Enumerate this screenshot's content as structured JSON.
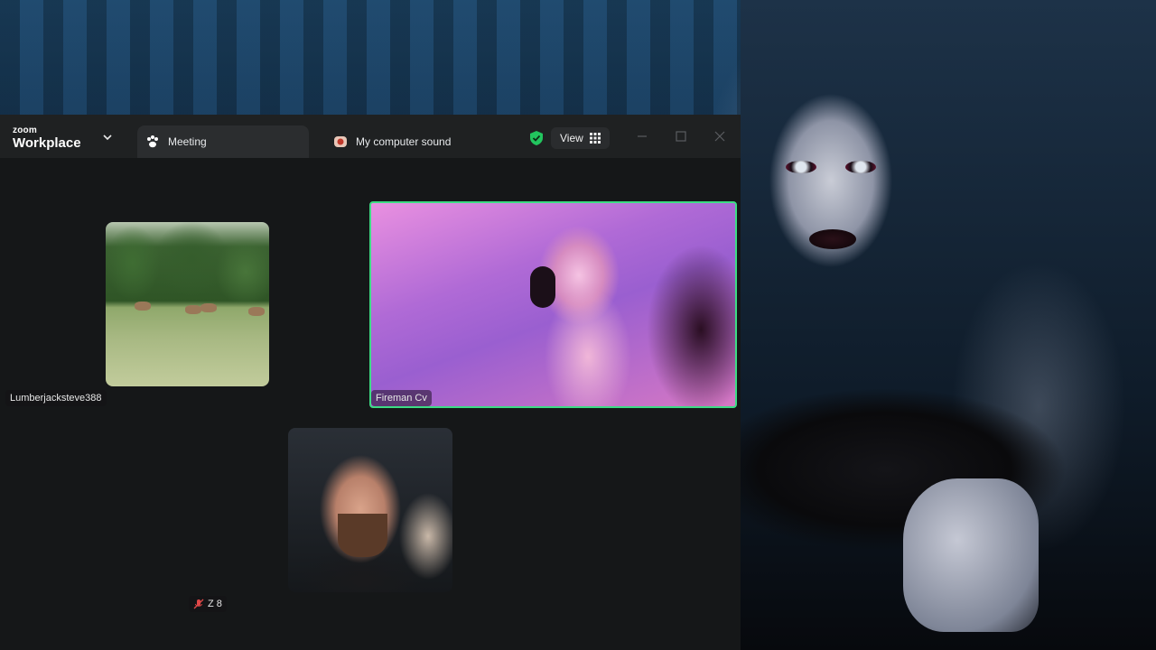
{
  "app": {
    "brand_small": "zoom",
    "brand_name": "Workplace"
  },
  "tabs": [
    {
      "label": "Meeting",
      "icon": "paw-icon",
      "active": true
    },
    {
      "label": "My computer sound",
      "icon": "app-icon",
      "active": false
    }
  ],
  "toolbar": {
    "view_label": "View",
    "security_icon": "shield-check-icon",
    "security_color": "#22c55e"
  },
  "participants": [
    {
      "name": "Lumberjacksteve388",
      "video": "deer-field"
    },
    {
      "name": "Fireman Cv",
      "video": "woman-headphones",
      "active_speaker": true
    },
    {
      "name": "Z 8",
      "video": "man-beard",
      "muted": true
    }
  ],
  "colors": {
    "active_speaker_border": "#3ddc84",
    "window_bg": "#151718",
    "titlebar_bg": "#1f2122"
  }
}
